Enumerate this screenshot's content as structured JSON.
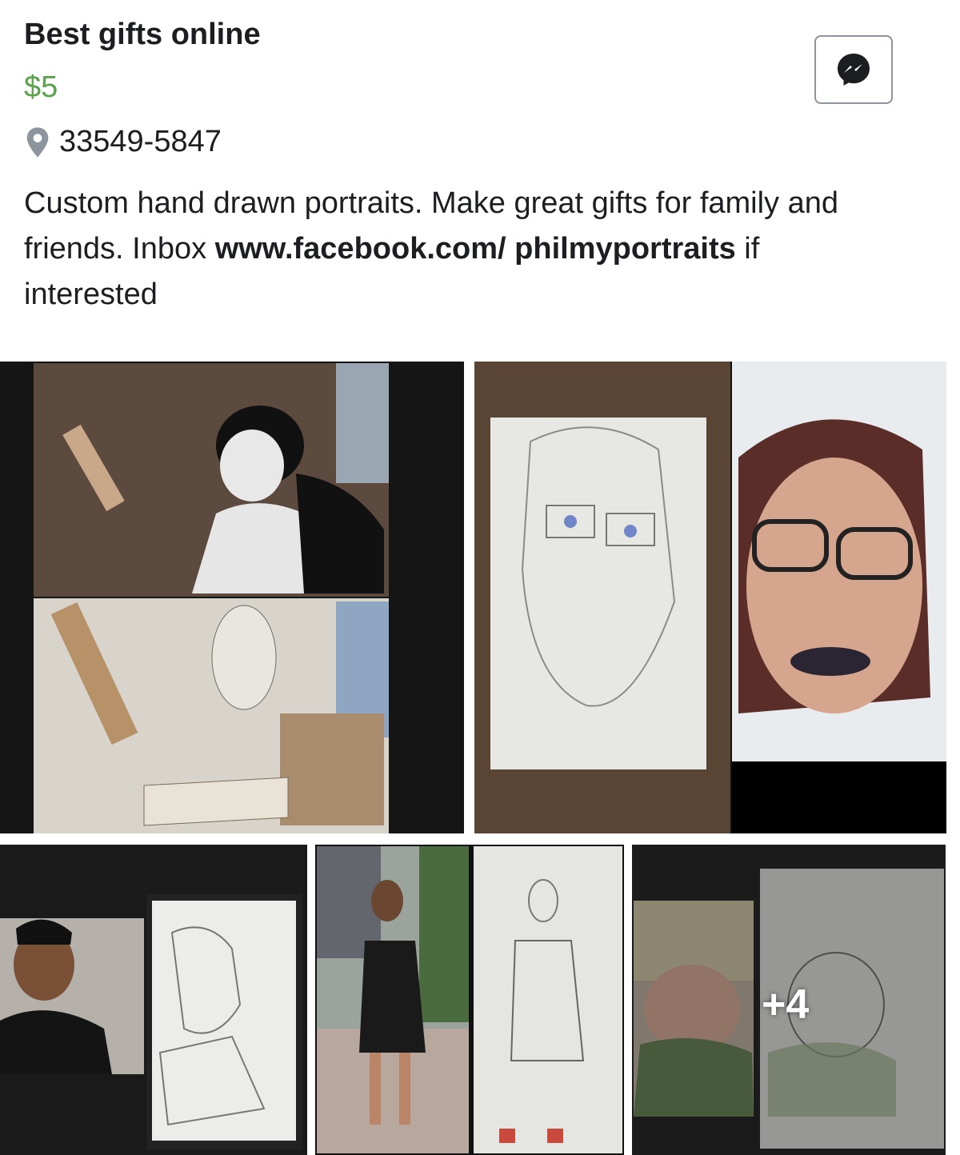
{
  "listing": {
    "title": "Best gifts online",
    "price": "$5",
    "location": "33549-5847",
    "description_part1": "Custom hand drawn portraits. Make great gifts for family and friends. Inbox ",
    "description_link": "www.facebook.com/ philmyportraits",
    "description_part2": " if interested"
  },
  "actions": {
    "messenger_icon": "messenger-icon"
  },
  "photos": {
    "more_count": "+4",
    "items": [
      {
        "name": "dog photo and crayon drawing"
      },
      {
        "name": "woman portrait drawing and photo"
      },
      {
        "name": "man photo and drawing"
      },
      {
        "name": "woman in black dress photo and drawing"
      },
      {
        "name": "baby photo and drawing"
      }
    ]
  },
  "colors": {
    "price": "#5aa34a",
    "text": "#1c1e21",
    "border": "#8d949e"
  }
}
